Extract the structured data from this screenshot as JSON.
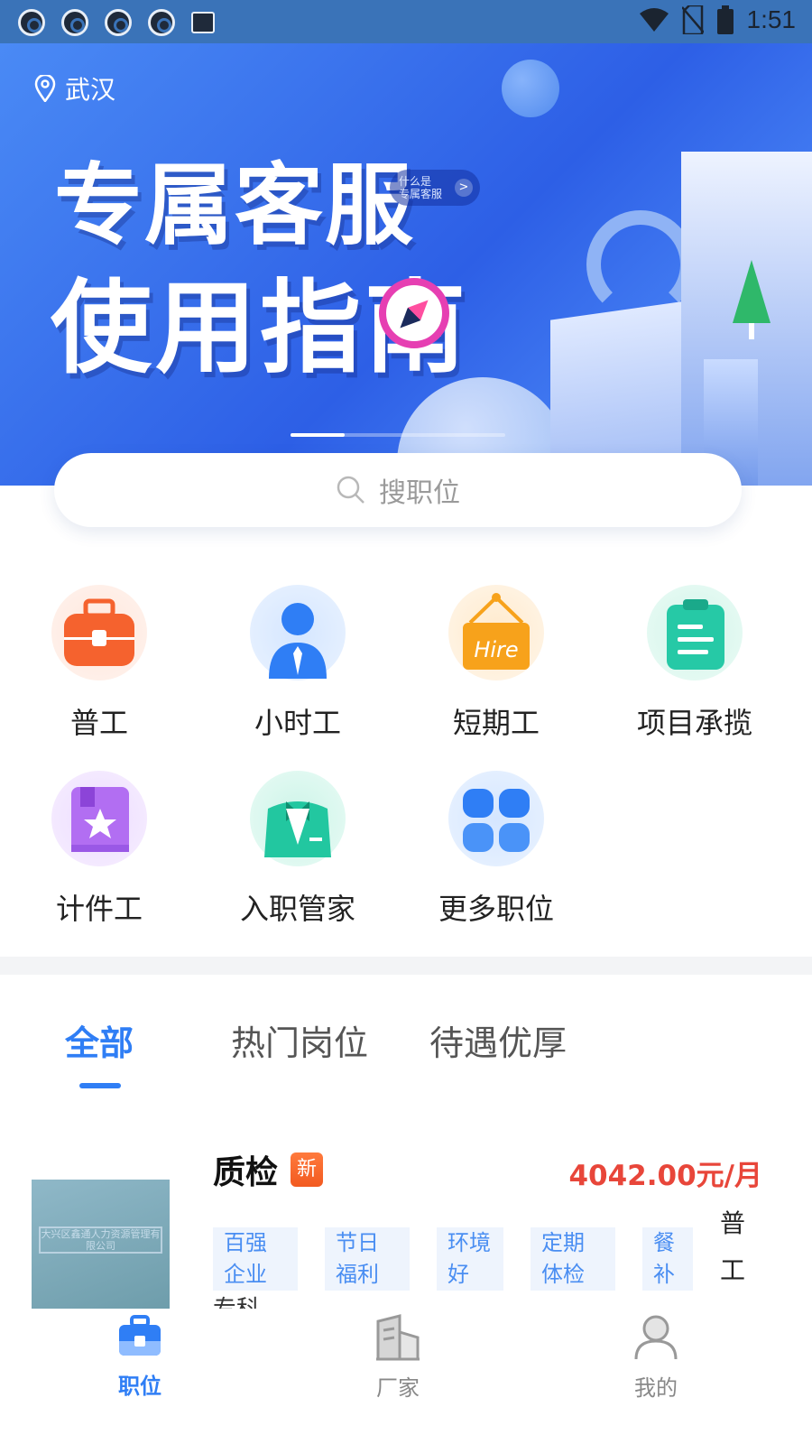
{
  "status_bar": {
    "time": "1:51",
    "icons": [
      "app-icon",
      "app-icon",
      "app-icon",
      "app-icon",
      "image-icon",
      "wifi-icon",
      "no-sim-icon",
      "battery-icon"
    ]
  },
  "banner": {
    "location": "武汉",
    "title_line1": "专属客服",
    "title_line2": "使用指南",
    "chip_text": "什么是\n专属客服",
    "chip_arrow": ">",
    "slide_count": 4,
    "active_slide": 1
  },
  "search": {
    "placeholder": "搜职位"
  },
  "categories": [
    {
      "label": "普工",
      "icon": "toolbox-icon",
      "color": "#f5622e"
    },
    {
      "label": "小时工",
      "icon": "person-icon",
      "color": "#2f7ef5"
    },
    {
      "label": "短期工",
      "icon": "hire-sign-icon",
      "color": "#f7a21b"
    },
    {
      "label": "项目承揽",
      "icon": "clipboard-icon",
      "color": "#26c9a6"
    },
    {
      "label": "计件工",
      "icon": "star-book-icon",
      "color": "#b26ef2"
    },
    {
      "label": "入职管家",
      "icon": "butler-icon",
      "color": "#22c7a0"
    },
    {
      "label": "更多职位",
      "icon": "grid-icon",
      "color": "#2f7ef5"
    }
  ],
  "tabs": [
    {
      "label": "全部",
      "active": true
    },
    {
      "label": "热门岗位",
      "active": false
    },
    {
      "label": "待遇优厚",
      "active": false
    }
  ],
  "job": {
    "title": "质检",
    "new_badge": "新",
    "salary": "4042.00元/月",
    "tags": [
      "百强企业",
      "节日福利",
      "环境好",
      "定期体检",
      "餐补"
    ],
    "type": "普工",
    "extra_line": "专科",
    "logo_text": "大兴区鑫通人力资源管理有限公司"
  },
  "bottom_nav": [
    {
      "label": "职位",
      "icon": "briefcase-icon",
      "active": true
    },
    {
      "label": "厂家",
      "icon": "building-icon",
      "active": false
    },
    {
      "label": "我的",
      "icon": "user-icon",
      "active": false
    }
  ],
  "colors": {
    "accent": "#2f7ef5",
    "salary": "#e8463a",
    "new_badge": "#f25a20",
    "banner": "#2d5fe6"
  }
}
